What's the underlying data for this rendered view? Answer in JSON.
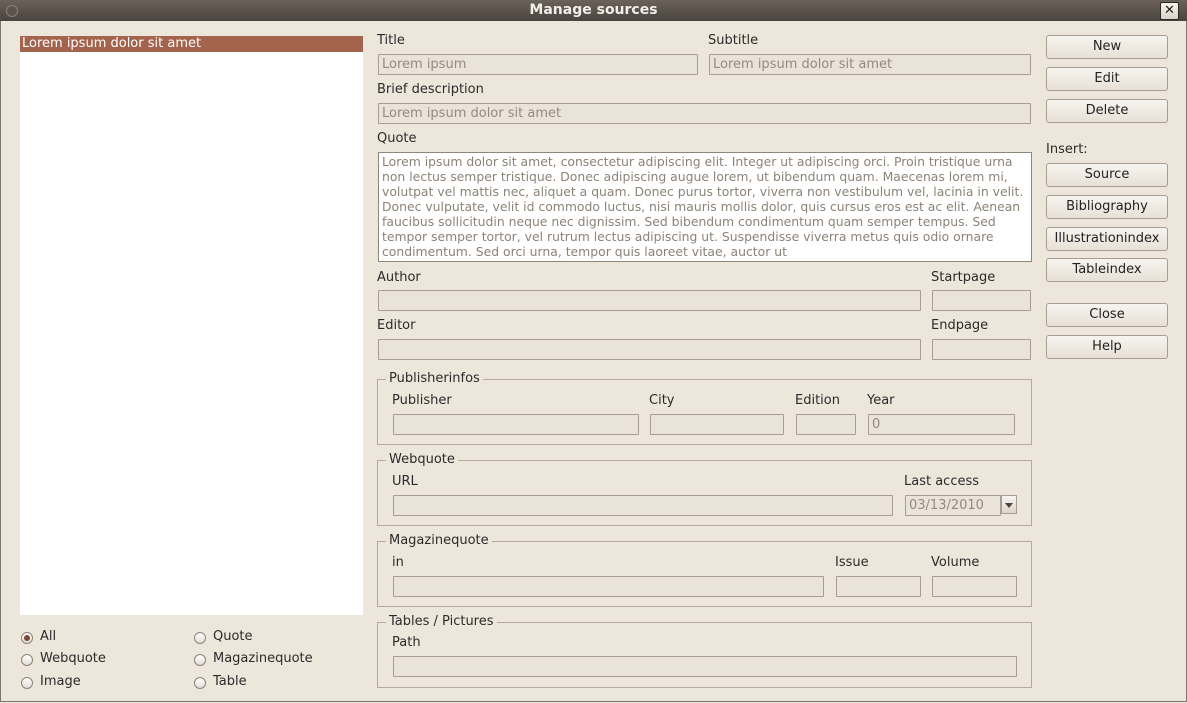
{
  "window": {
    "title": "Manage sources",
    "close_glyph": "✕"
  },
  "list": {
    "items": [
      "Lorem ipsum dolor sit amet"
    ]
  },
  "filters": {
    "all": "All",
    "quote": "Quote",
    "webquote": "Webquote",
    "magazinequote": "Magazinequote",
    "image": "Image",
    "table": "Table",
    "selected": "All"
  },
  "form": {
    "title_label": "Title",
    "title_value": "Lorem ipsum",
    "subtitle_label": "Subtitle",
    "subtitle_value": "Lorem ipsum dolor sit amet",
    "brief_label": "Brief description",
    "brief_value": "Lorem ipsum dolor sit amet",
    "quote_label": "Quote",
    "quote_value": "Lorem ipsum dolor sit amet, consectetur adipiscing elit. Integer ut adipiscing orci. Proin tristique urna non lectus semper tristique. Donec adipiscing augue lorem, ut bibendum quam. Maecenas lorem mi, volutpat vel mattis nec, aliquet a quam. Donec purus tortor, viverra non vestibulum vel, lacinia in velit. Donec vulputate, velit id commodo luctus, nisi mauris mollis dolor, quis cursus eros est ac elit. Aenean faucibus sollicitudin neque nec dignissim. Sed bibendum condimentum quam semper tempus. Sed tempor semper tortor, vel rutrum lectus adipiscing ut. Suspendisse viverra metus quis odio ornare condimentum. Sed orci urna, tempor quis laoreet vitae, auctor ut",
    "author_label": "Author",
    "author_value": "",
    "startpage_label": "Startpage",
    "startpage_value": "",
    "editor_label": "Editor",
    "editor_value": "",
    "endpage_label": "Endpage",
    "endpage_value": ""
  },
  "publisher": {
    "group_title": "Publisherinfos",
    "publisher_label": "Publisher",
    "publisher_value": "",
    "city_label": "City",
    "city_value": "",
    "edition_label": "Edition",
    "edition_value": "",
    "year_label": "Year",
    "year_value": "0"
  },
  "web": {
    "group_title": "Webquote",
    "url_label": "URL",
    "url_value": "",
    "lastaccess_label": "Last access",
    "lastaccess_value": "03/13/2010"
  },
  "magazine": {
    "group_title": "Magazinequote",
    "in_label": "in",
    "in_value": "",
    "issue_label": "Issue",
    "issue_value": "",
    "volume_label": "Volume",
    "volume_value": ""
  },
  "tables": {
    "group_title": "Tables / Pictures",
    "path_label": "Path",
    "path_value": ""
  },
  "buttons": {
    "new": "New",
    "edit": "Edit",
    "delete": "Delete",
    "insert_label": "Insert:",
    "source": "Source",
    "bibliography": "Bibliography",
    "illustrationindex": "Illustrationindex",
    "tableindex": "Tableindex",
    "close": "Close",
    "help": "Help"
  }
}
